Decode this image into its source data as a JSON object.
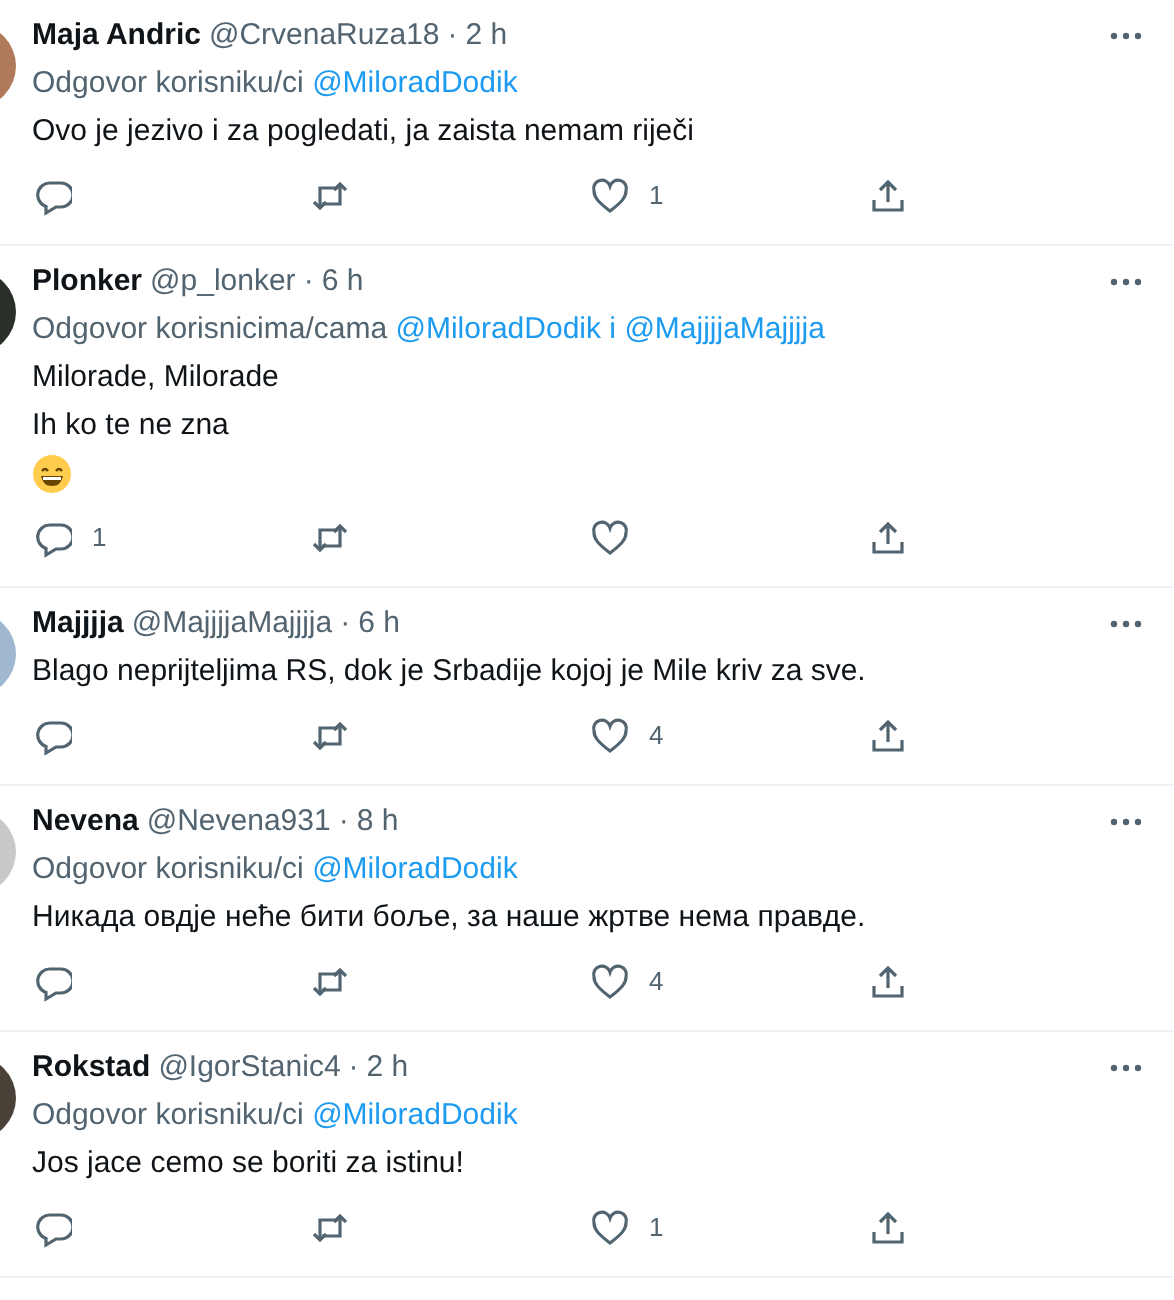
{
  "tweets": [
    {
      "name": "Maja Andric",
      "handle": "@CrvenaRuza18",
      "separator": "·",
      "time": "2 h",
      "reply_to": [
        {
          "kind": "plain",
          "text": "Odgovor korisniku/ci"
        },
        {
          "kind": "mention",
          "text": "@MiloradDodik"
        }
      ],
      "content": [
        {
          "kind": "text",
          "text": "Ovo je jezivo i za pogledati, ja zaista nemam riječi"
        }
      ],
      "actions": [
        {
          "kind": "reply"
        },
        {
          "kind": "retweet"
        },
        {
          "kind": "like",
          "count": "1"
        },
        {
          "kind": "share"
        }
      ]
    },
    {
      "name": "Plonker",
      "handle": "@p_lonker",
      "separator": "·",
      "time": "6 h",
      "reply_to": [
        {
          "kind": "plain",
          "text": "Odgovor korisnicima/cama"
        },
        {
          "kind": "mention",
          "text": "@MiloradDodik"
        },
        {
          "kind": "joiner",
          "text": "i"
        },
        {
          "kind": "mention",
          "text": "@MajjjjaMajjjja"
        }
      ],
      "content": [
        {
          "kind": "text",
          "text": "Milorade, Milorade"
        },
        {
          "kind": "text",
          "text": "Ih ko te ne zna"
        },
        {
          "kind": "emoji"
        }
      ],
      "actions": [
        {
          "kind": "reply",
          "count": "1"
        },
        {
          "kind": "retweet"
        },
        {
          "kind": "like"
        },
        {
          "kind": "share"
        }
      ]
    },
    {
      "name": "Majjjja",
      "handle": "@MajjjjaMajjjja",
      "separator": "·",
      "time": "6 h",
      "content": [
        {
          "kind": "text",
          "text": "Blago neprijteljima RS, dok je Srbadije kojoj je Mile kriv za sve."
        }
      ],
      "actions": [
        {
          "kind": "reply"
        },
        {
          "kind": "retweet"
        },
        {
          "kind": "like",
          "count": "4"
        },
        {
          "kind": "share"
        }
      ]
    },
    {
      "name": "Nevena",
      "handle": "@Nevena931",
      "separator": "·",
      "time": "8 h",
      "reply_to": [
        {
          "kind": "plain",
          "text": "Odgovor korisniku/ci"
        },
        {
          "kind": "mention",
          "text": "@MiloradDodik"
        }
      ],
      "content": [
        {
          "kind": "text",
          "text": "Никада овдје неће бити боље, за наше жртве нема правде."
        }
      ],
      "actions": [
        {
          "kind": "reply"
        },
        {
          "kind": "retweet"
        },
        {
          "kind": "like",
          "count": "4"
        },
        {
          "kind": "share"
        }
      ]
    },
    {
      "name": "Rokstad",
      "handle": "@IgorStanic4",
      "separator": "·",
      "time": "2 h",
      "reply_to": [
        {
          "kind": "plain",
          "text": "Odgovor korisniku/ci"
        },
        {
          "kind": "mention",
          "text": "@MiloradDodik"
        }
      ],
      "content": [
        {
          "kind": "text",
          "text": "Jos jace cemo se boriti za istinu!"
        }
      ],
      "actions": [
        {
          "kind": "reply"
        },
        {
          "kind": "retweet"
        },
        {
          "kind": "like",
          "count": "1"
        },
        {
          "kind": "share"
        }
      ]
    }
  ]
}
